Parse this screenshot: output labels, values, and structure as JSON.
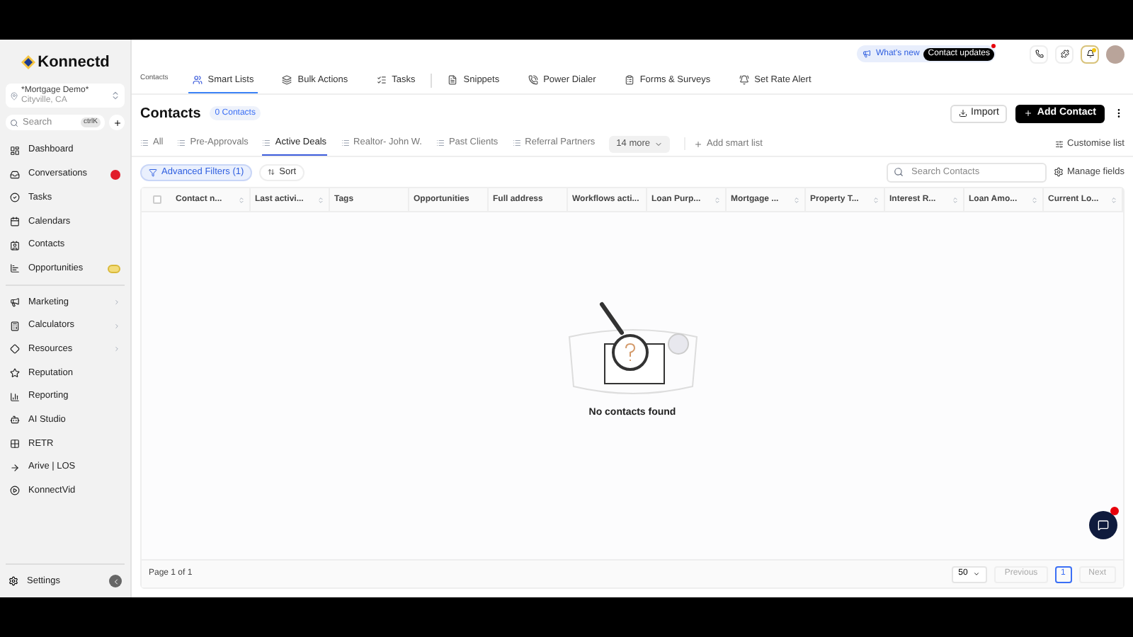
{
  "sidebar": {
    "brand": "Konnectd",
    "account": {
      "name": "*Mortgage Demo*",
      "location": "Cityville, CA"
    },
    "search": {
      "placeholder": "Search",
      "shortcut": "ctrlK"
    },
    "groups": [
      [
        {
          "label": "Dashboard",
          "expandable": false,
          "alert": false,
          "promo": false
        },
        {
          "label": "Conversations",
          "expandable": false,
          "alert": true,
          "promo": false
        },
        {
          "label": "Tasks",
          "expandable": false,
          "alert": false,
          "promo": false
        },
        {
          "label": "Calendars",
          "expandable": false,
          "alert": false,
          "promo": false
        },
        {
          "label": "Contacts",
          "expandable": false,
          "alert": false,
          "promo": false
        },
        {
          "label": "Opportunities",
          "expandable": false,
          "alert": false,
          "promo": true
        }
      ],
      [
        {
          "label": "Marketing",
          "expandable": true,
          "alert": false,
          "promo": false
        },
        {
          "label": "Calculators",
          "expandable": true,
          "alert": false,
          "promo": false
        },
        {
          "label": "Resources",
          "expandable": true,
          "alert": false,
          "promo": false
        },
        {
          "label": "Reputation",
          "expandable": false,
          "alert": false,
          "promo": false
        },
        {
          "label": "Reporting",
          "expandable": false,
          "alert": false,
          "promo": false
        },
        {
          "label": "AI Studio",
          "expandable": false,
          "alert": false,
          "promo": false
        },
        {
          "label": "RETR",
          "expandable": false,
          "alert": false,
          "promo": false
        },
        {
          "label": "Arive | LOS",
          "expandable": false,
          "alert": false,
          "promo": false
        },
        {
          "label": "KonnectVid",
          "expandable": false,
          "alert": false,
          "promo": false
        }
      ]
    ],
    "settings": "Settings"
  },
  "header": {
    "whats_new": "What's new",
    "update": "Contact updates",
    "update_unread": true,
    "bell_unread": true
  },
  "nav": {
    "section": "Contacts",
    "tabs": [
      {
        "label": "Smart Lists",
        "selected": true
      },
      {
        "label": "Bulk Actions",
        "selected": false
      },
      {
        "label": "Tasks",
        "selected": false
      },
      {
        "label": "Snippets",
        "selected": false
      },
      {
        "label": "Power Dialer",
        "selected": false
      },
      {
        "label": "Forms & Surveys",
        "selected": false
      },
      {
        "label": "Set Rate Alert",
        "selected": false
      }
    ]
  },
  "page": {
    "title": "Contacts",
    "count": "0 Contacts",
    "import": "Import",
    "add": "Add Contact"
  },
  "lists": {
    "tabs": [
      {
        "label": "All",
        "selected": false
      },
      {
        "label": "Pre-Approvals",
        "selected": false
      },
      {
        "label": "Active Deals",
        "selected": true
      },
      {
        "label": "Realtor- John W.",
        "selected": false
      },
      {
        "label": "Past Clients",
        "selected": false
      },
      {
        "label": "Referral Partners",
        "selected": false
      }
    ],
    "more": "14 more",
    "add": "Add smart list",
    "customise": "Customise list"
  },
  "toolbar": {
    "filters": "Advanced Filters (1)",
    "filters_active": true,
    "sort": "Sort",
    "search_placeholder": "Search Contacts",
    "manage": "Manage fields"
  },
  "table": {
    "select_all": {
      "checked": false
    },
    "columns": [
      {
        "label": "Contact n...",
        "sortable": true
      },
      {
        "label": "Last activi...",
        "sortable": true
      },
      {
        "label": "Tags",
        "sortable": false
      },
      {
        "label": "Opportunities",
        "sortable": false
      },
      {
        "label": "Full address",
        "sortable": false
      },
      {
        "label": "Workflows acti...",
        "sortable": false
      },
      {
        "label": "Loan Purp...",
        "sortable": true
      },
      {
        "label": "Mortgage ...",
        "sortable": true
      },
      {
        "label": "Property T...",
        "sortable": true
      },
      {
        "label": "Interest R...",
        "sortable": true
      },
      {
        "label": "Loan Amo...",
        "sortable": true
      },
      {
        "label": "Current Lo...",
        "sortable": true
      }
    ],
    "empty": "No contacts found"
  },
  "footer": {
    "page_info": "Page 1 of 1",
    "per_page": "50",
    "previous": "Previous",
    "previous_disabled": true,
    "pages": [
      {
        "label": "1",
        "selected": true
      }
    ],
    "next": "Next",
    "next_disabled": true
  },
  "chat": {
    "unread": true
  }
}
